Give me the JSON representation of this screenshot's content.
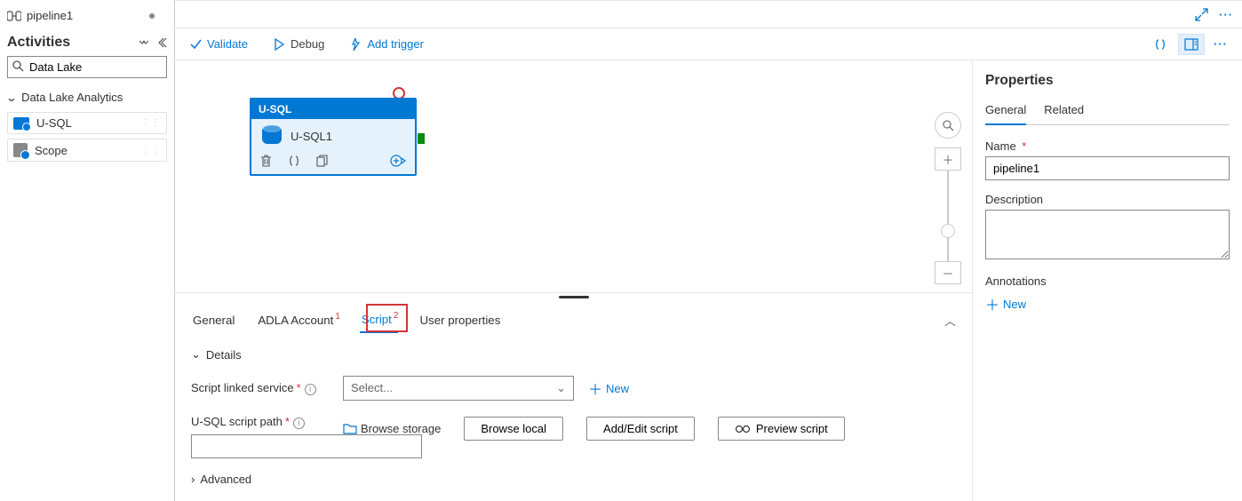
{
  "tab": {
    "name": "pipeline1"
  },
  "sidebar": {
    "title": "Activities",
    "search_placeholder": "Data Lake",
    "category": "Data Lake Analytics",
    "items": [
      "U-SQL",
      "Scope"
    ]
  },
  "toolbar": {
    "validate": "Validate",
    "debug": "Debug",
    "add_trigger": "Add trigger"
  },
  "node": {
    "type": "U-SQL",
    "name": "U-SQL1"
  },
  "bottom_tabs": {
    "general": "General",
    "adla": "ADLA Account",
    "script": "Script",
    "user_props": "User properties",
    "badge1": "1",
    "badge2": "2"
  },
  "details": {
    "header": "Details",
    "linked_label": "Script linked service",
    "select_placeholder": "Select...",
    "new": "New",
    "path_label": "U-SQL script path",
    "browse_storage": "Browse storage",
    "browse_local": "Browse local",
    "add_edit": "Add/Edit script",
    "preview": "Preview script",
    "advanced": "Advanced"
  },
  "props": {
    "title": "Properties",
    "tab_general": "General",
    "tab_related": "Related",
    "name_label": "Name",
    "name_value": "pipeline1",
    "desc_label": "Description",
    "ann_label": "Annotations",
    "new": "New"
  }
}
